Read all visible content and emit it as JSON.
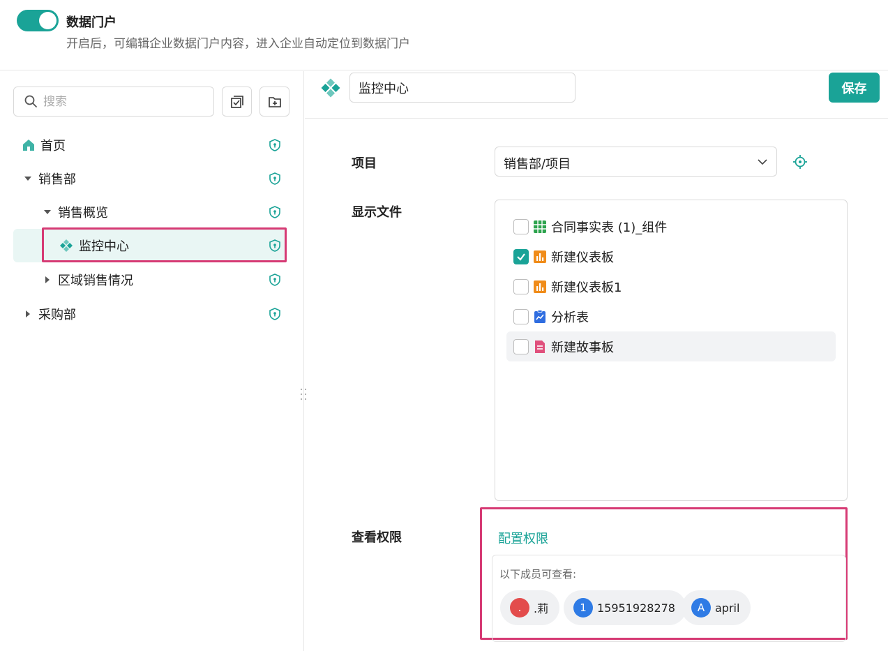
{
  "header": {
    "toggle_on": true,
    "title": "数据门户",
    "description": "开启后，可编辑企业数据门户内容，进入企业自动定位到数据门户"
  },
  "sidebar": {
    "search_placeholder": "搜索",
    "actions": [
      "batch-select-icon",
      "new-folder-icon"
    ],
    "tree": [
      {
        "label": "首页",
        "icon": "home-icon",
        "level": 0,
        "expanded": null
      },
      {
        "label": "销售部",
        "level": 0,
        "expanded": true
      },
      {
        "label": "销售概览",
        "level": 1,
        "expanded": true
      },
      {
        "label": "监控中心",
        "icon": "dashboard-diamond-icon",
        "level": 2,
        "selected": true
      },
      {
        "label": "区域销售情况",
        "level": 1,
        "expanded": false
      },
      {
        "label": "采购部",
        "level": 0,
        "expanded": false
      }
    ]
  },
  "main": {
    "page_name": "监控中心",
    "save_label": "保存",
    "project_label": "项目",
    "project_value": "销售部/项目",
    "files_label": "显示文件",
    "files": [
      {
        "name": "合同事实表 (1)_组件",
        "icon": "table-icon",
        "checked": false
      },
      {
        "name": "新建仪表板",
        "icon": "dashboard-icon",
        "checked": true
      },
      {
        "name": "新建仪表板1",
        "icon": "dashboard-icon",
        "checked": false
      },
      {
        "name": "分析表",
        "icon": "analysis-icon",
        "checked": false
      },
      {
        "name": "新建故事板",
        "icon": "storyboard-icon",
        "checked": false
      }
    ],
    "permission_label": "查看权限",
    "configure_link": "配置权限",
    "members_title": "以下成员可查看:",
    "members": [
      {
        "avatar": ".",
        "name": ".莉",
        "color": "#e34c4c"
      },
      {
        "avatar": "1",
        "name": "15951928278",
        "color": "#2f7be5"
      },
      {
        "avatar": "A",
        "name": "april",
        "color": "#2f7be5"
      }
    ]
  },
  "colors": {
    "accent": "#1aa397",
    "highlight": "#d63a74",
    "selected_bg": "#e9f6f4"
  }
}
